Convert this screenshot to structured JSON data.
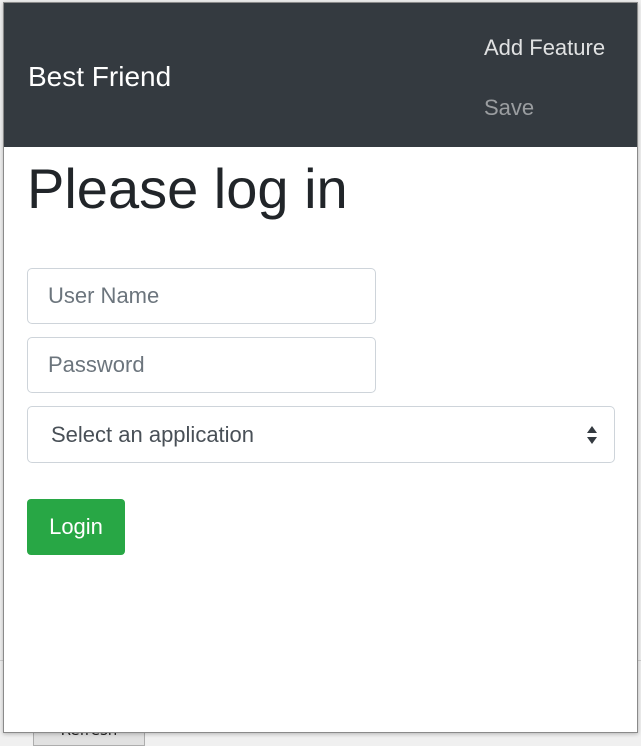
{
  "background_window": {
    "button_label": "Refresh"
  },
  "navbar": {
    "brand": "Best Friend",
    "links": [
      "Add Feature",
      "Save"
    ],
    "background_color": "#343a40"
  },
  "main": {
    "title": "Please log in",
    "username": {
      "value": "",
      "placeholder": "User Name"
    },
    "password": {
      "value": "",
      "placeholder": "Password"
    },
    "application_select": {
      "selected": "Select an application"
    },
    "login_label": "Login",
    "login_color": "#28a745"
  }
}
